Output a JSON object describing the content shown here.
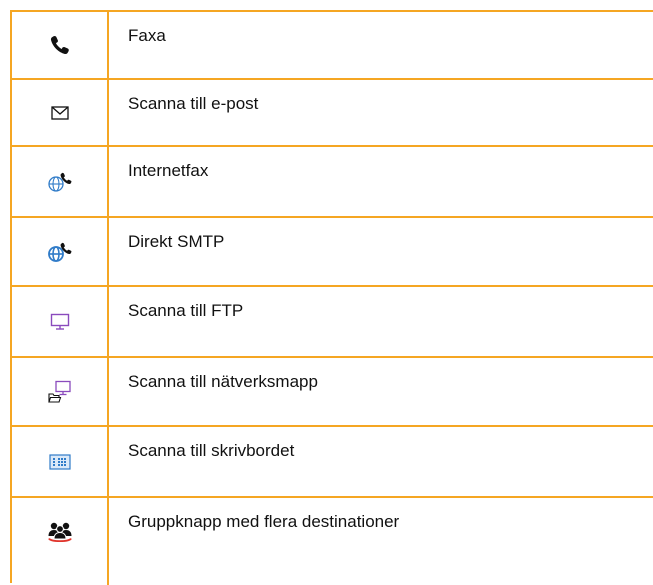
{
  "rows": [
    {
      "label": "Faxa",
      "icon": "phone-icon"
    },
    {
      "label": "Scanna till e-post",
      "icon": "envelope-icon"
    },
    {
      "label": "Internetfax",
      "icon": "globe-phone-icon"
    },
    {
      "label": "Direkt SMTP",
      "icon": "globe-phone-bold-icon"
    },
    {
      "label": "Scanna till FTP",
      "icon": "monitor-icon"
    },
    {
      "label": "Scanna till nätverksmapp",
      "icon": "monitor-folder-icon"
    },
    {
      "label": "Scanna till skrivbordet",
      "icon": "desktop-grid-icon"
    },
    {
      "label": "Gruppknapp med flera destinationer",
      "icon": "group-icon"
    }
  ],
  "colors": {
    "border": "#f5a623",
    "blue": "#2f7bc8",
    "purple": "#8a4bbd",
    "red": "#e0342b"
  }
}
